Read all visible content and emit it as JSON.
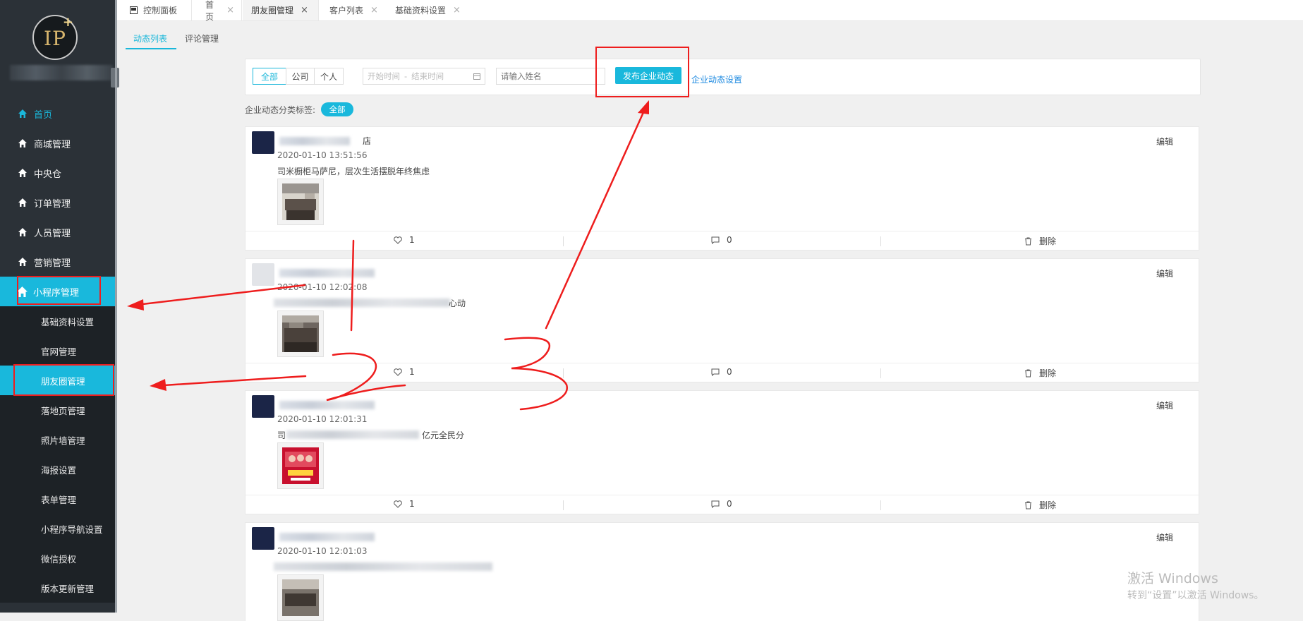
{
  "top_tabs": [
    {
      "label": "控制面板",
      "closable": false
    },
    {
      "label": "首页",
      "closable": true
    },
    {
      "label": "朋友圈管理",
      "closable": true,
      "active": true
    },
    {
      "label": "客户列表",
      "closable": true
    },
    {
      "label": "基础资料设置",
      "closable": true
    }
  ],
  "logo": {
    "text": "IP",
    "plus": "+"
  },
  "sidebar": {
    "items": [
      {
        "label": "首页",
        "icon": "home-icon",
        "active": true
      },
      {
        "label": "商城管理",
        "icon": "home-icon"
      },
      {
        "label": "中央仓",
        "icon": "home-icon"
      },
      {
        "label": "订单管理",
        "icon": "home-icon"
      },
      {
        "label": "人员管理",
        "icon": "home-icon"
      },
      {
        "label": "营销管理",
        "icon": "home-icon"
      },
      {
        "label": "小程序管理",
        "icon": "home-icon",
        "expanded": true
      }
    ],
    "subitems": [
      {
        "label": "基础资料设置"
      },
      {
        "label": "官网管理"
      },
      {
        "label": "朋友圈管理",
        "active": true
      },
      {
        "label": "落地页管理"
      },
      {
        "label": "照片墙管理"
      },
      {
        "label": "海报设置"
      },
      {
        "label": "表单管理"
      },
      {
        "label": "小程序导航设置"
      },
      {
        "label": "微信授权"
      },
      {
        "label": "版本更新管理"
      }
    ]
  },
  "sub_tabs": [
    {
      "label": "动态列表",
      "active": true
    },
    {
      "label": "评论管理"
    }
  ],
  "filter": {
    "segments": [
      "全部",
      "公司",
      "个人"
    ],
    "date_start_placeholder": "开始时间",
    "date_sep": "-",
    "date_end_placeholder": "结束时间",
    "name_placeholder": "请输入姓名",
    "publish_label": "发布企业动态",
    "settings_label": "企业动态设置"
  },
  "tags": {
    "label": "企业动态分类标签:",
    "all": "全部"
  },
  "posts": [
    {
      "name": "店",
      "date": "2020-01-10 13:51:56",
      "content": "司米橱柜马萨尼，层次生活摆脱年终焦虑",
      "likes": "1",
      "comments": "0",
      "delete": "删除",
      "edit": "编辑"
    },
    {
      "name": "",
      "date": "2020-01-10 12:02:08",
      "content": "心动",
      "likes": "1",
      "comments": "0",
      "delete": "删除",
      "edit": "编辑"
    },
    {
      "name": "",
      "date": "2020-01-10 12:01:31",
      "content": "司",
      "content_tail": "亿元全民分",
      "likes": "1",
      "comments": "0",
      "delete": "删除",
      "edit": "编辑"
    },
    {
      "name": "",
      "date": "2020-01-10 12:01:03",
      "content": "",
      "edit": "编辑"
    }
  ],
  "watermark": {
    "line1": "激活 Windows",
    "line2": "转到“设置”以激活 Windows。"
  },
  "colors": {
    "accent": "#19b8dc",
    "sidebar": "#2b3137",
    "annotation": "#ee1d1d",
    "link": "#1a88e0"
  }
}
